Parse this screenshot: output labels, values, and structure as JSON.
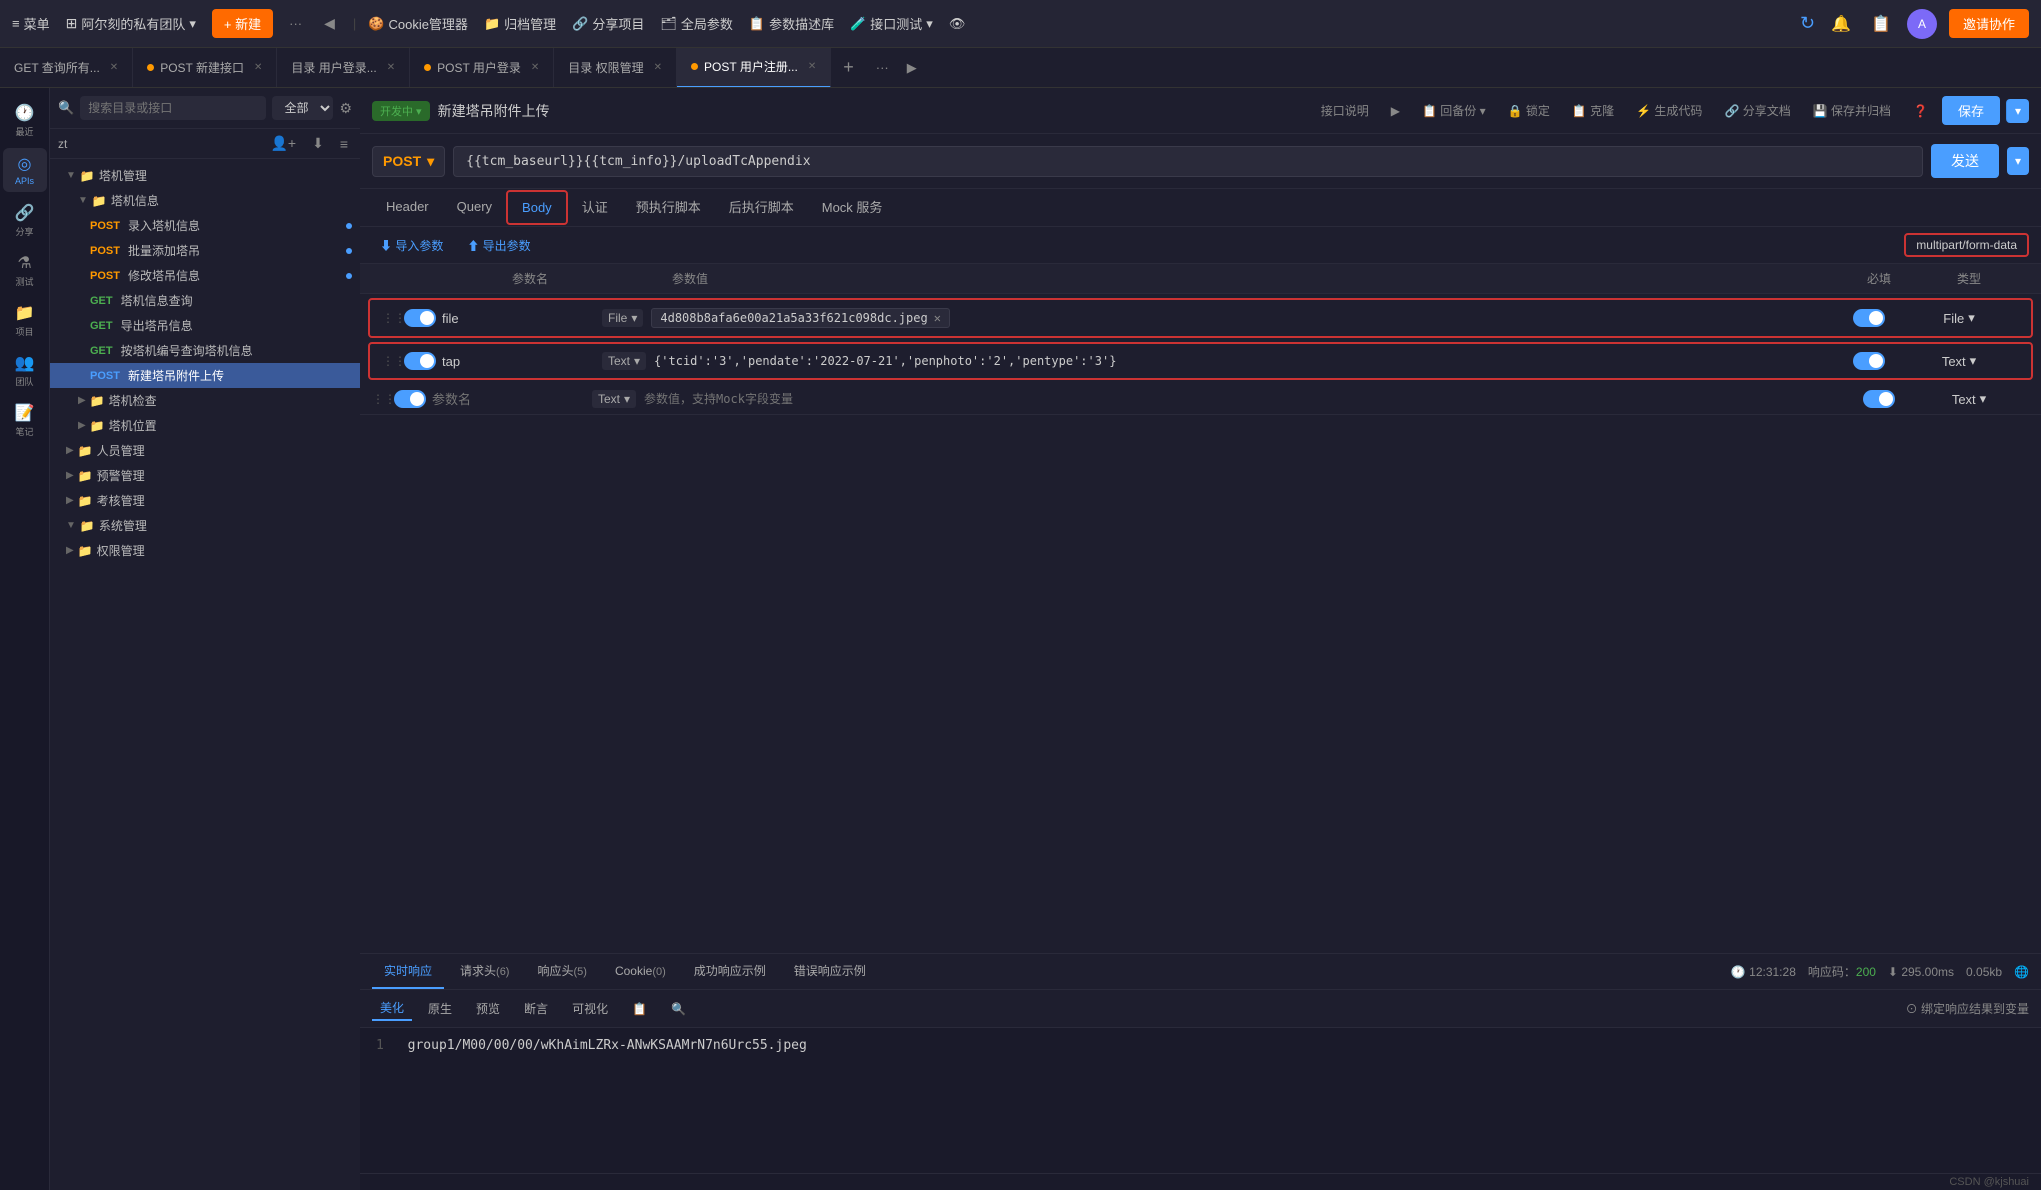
{
  "topbar": {
    "menu_label": "菜单",
    "team_label": "阿尔刻的私有团队",
    "new_label": "+ 新建",
    "dots": "···",
    "nav_back": "◀",
    "tools": [
      {
        "label": "Cookie管理器",
        "icon": "🍪"
      },
      {
        "label": "归档管理",
        "icon": "📁"
      },
      {
        "label": "分享项目",
        "icon": "🔗"
      },
      {
        "label": "全局参数",
        "icon": "🗂"
      },
      {
        "label": "参数描述库",
        "icon": "📋"
      },
      {
        "label": "接口测试",
        "icon": "🧪"
      },
      {
        "label": "👁",
        "icon": ""
      }
    ],
    "invite_label": "邀请协作"
  },
  "tabs": [
    {
      "label": "GET 查询所有...",
      "dot": "none",
      "active": false
    },
    {
      "label": "POST 新建接口",
      "dot": "orange",
      "active": false
    },
    {
      "label": "目录 用户登录...",
      "dot": "none",
      "active": false
    },
    {
      "label": "POST 用户登录",
      "dot": "orange",
      "active": false
    },
    {
      "label": "目录 权限管理",
      "dot": "none",
      "active": false
    },
    {
      "label": "POST 用户注册...",
      "dot": "orange",
      "active": true
    }
  ],
  "sidebar": {
    "search_placeholder": "搜索目录或接口",
    "search_filter": "全部",
    "section_label": "zt",
    "icons": [
      {
        "label": "最近",
        "glyph": "🕐"
      },
      {
        "label": "APIs",
        "glyph": "◎"
      },
      {
        "label": "分享",
        "glyph": "🔗"
      },
      {
        "label": "测试",
        "glyph": "⚗"
      },
      {
        "label": "项目",
        "glyph": "📁"
      },
      {
        "label": "团队",
        "glyph": "👥"
      },
      {
        "label": "笔记",
        "glyph": "📝"
      }
    ],
    "tree": [
      {
        "level": 1,
        "type": "folder",
        "label": "塔机管理",
        "expanded": true
      },
      {
        "level": 2,
        "type": "folder",
        "label": "塔机信息",
        "expanded": true
      },
      {
        "level": 3,
        "type": "api",
        "method": "POST",
        "label": "录入塔机信息",
        "dot": true
      },
      {
        "level": 3,
        "type": "api",
        "method": "POST",
        "label": "批量添加塔吊",
        "dot": true
      },
      {
        "level": 3,
        "type": "api",
        "method": "POST",
        "label": "修改塔吊信息",
        "dot": true
      },
      {
        "level": 3,
        "type": "api",
        "method": "GET",
        "label": "塔机信息查询"
      },
      {
        "level": 3,
        "type": "api",
        "method": "GET",
        "label": "导出塔吊信息"
      },
      {
        "level": 3,
        "type": "api",
        "method": "GET",
        "label": "按塔机编号查询塔机信息"
      },
      {
        "level": 3,
        "type": "api",
        "method": "POST",
        "label": "新建塔吊附件上传",
        "active": true
      },
      {
        "level": 2,
        "type": "folder",
        "label": "塔机检查",
        "expanded": false
      },
      {
        "level": 2,
        "type": "folder",
        "label": "塔机位置",
        "expanded": false
      },
      {
        "level": 1,
        "type": "folder",
        "label": "人员管理",
        "expanded": false
      },
      {
        "level": 1,
        "type": "folder",
        "label": "预警管理",
        "expanded": false
      },
      {
        "level": 1,
        "type": "folder",
        "label": "考核管理",
        "expanded": false
      },
      {
        "level": 1,
        "type": "folder",
        "label": "系统管理",
        "expanded": true
      },
      {
        "level": 1,
        "type": "folder",
        "label": "权限管理",
        "expanded": false
      }
    ]
  },
  "api": {
    "status": "开发中",
    "title": "新建塔吊附件上传",
    "toolbar_buttons": [
      "接口说明",
      "▶",
      "回备份",
      "🔒 锁定",
      "克隆",
      "生成代码",
      "分享文档",
      "保存并归档",
      "❓"
    ],
    "save_label": "保存",
    "method": "POST",
    "url": "{{tcm_baseurl}}{{tcm_info}}/uploadTcAppendix",
    "send_label": "发送"
  },
  "request_tabs": [
    {
      "label": "Header",
      "active": false
    },
    {
      "label": "Query",
      "active": false
    },
    {
      "label": "Body",
      "active": true,
      "highlighted": true
    },
    {
      "label": "认证",
      "active": false
    },
    {
      "label": "预执行脚本",
      "active": false
    },
    {
      "label": "后执行脚本",
      "active": false
    },
    {
      "label": "Mock 服务",
      "active": false
    }
  ],
  "params_toolbar": {
    "import_label": "⬇ 导入参数",
    "export_label": "⬆ 导出参数",
    "content_type": "multipart/form-data"
  },
  "table_headers": {
    "param_name": "参数名",
    "param_value": "参数值",
    "required": "必填",
    "type": "类型"
  },
  "table_rows": [
    {
      "enabled": true,
      "name": "file",
      "value_type": "File",
      "value": "4d808b8afa6e00a21a5a33f621c098dc.jpeg",
      "required": true,
      "type": "File"
    },
    {
      "enabled": true,
      "name": "tap",
      "value_type": "Text",
      "value": "{'tcid':'3','pendate':'2022-07-21','penphoto':'2','pentype':'3'}",
      "required": true,
      "type": "Text"
    },
    {
      "enabled": true,
      "name": "",
      "value_type": "Text",
      "value": "",
      "placeholder_name": "参数名",
      "placeholder_value": "参数值，支持Mock字段变量",
      "required": true,
      "type": "Text"
    }
  ],
  "response": {
    "tabs": [
      {
        "label": "实时响应",
        "active": true
      },
      {
        "label": "请求头",
        "count": "6",
        "active": false
      },
      {
        "label": "响应头",
        "count": "5",
        "active": false
      },
      {
        "label": "Cookie",
        "count": "0",
        "active": false
      },
      {
        "label": "成功响应示例",
        "active": false
      },
      {
        "label": "错误响应示例",
        "active": false
      }
    ],
    "time": "12:31:28",
    "status_label": "响应码：",
    "status_value": "200",
    "duration_label": "295.00ms",
    "size": "0.05kb",
    "tools": [
      "美化",
      "原生",
      "预览",
      "断言",
      "可视化",
      "📋",
      "🔍"
    ],
    "bind_label": "⊙ 绑定响应结果到变量",
    "content_line": "1",
    "content_value": "group1/M00/00/00/wKhAimLZRx-ANwKSAAMrN7n6Urc55.jpeg"
  }
}
